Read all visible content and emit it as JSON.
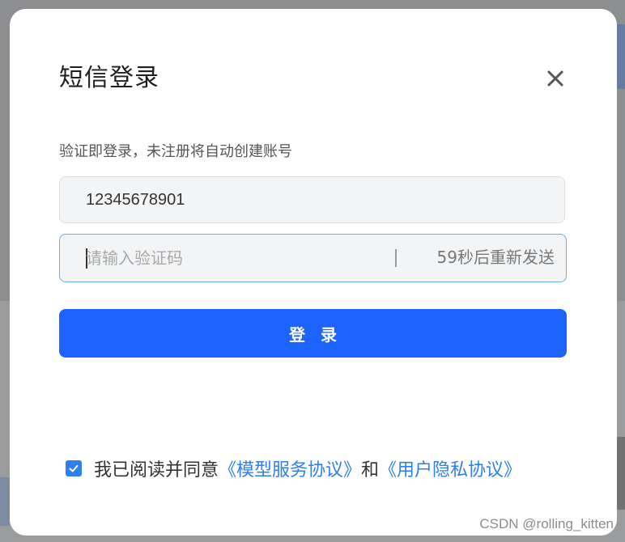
{
  "modal": {
    "title": "短信登录",
    "subtitle": "验证即登录，未注册将自动创建账号",
    "close_icon": "close-icon"
  },
  "phone": {
    "value": "12345678901"
  },
  "code": {
    "value": "",
    "placeholder": "请输入验证码",
    "resend_label": "59秒后重新发送",
    "divider_char": "|"
  },
  "login": {
    "label": "登 录"
  },
  "agreement": {
    "checked": true,
    "prefix": "我已阅读并同意",
    "model_terms": "《模型服务协议》",
    "conjunction": "和",
    "privacy_terms": "《用户隐私协议》"
  },
  "watermark": "CSDN @rolling_kitten",
  "colors": {
    "primary": "#1d63fe",
    "link": "#2f7ff0",
    "focus_border": "#6aaee8"
  }
}
